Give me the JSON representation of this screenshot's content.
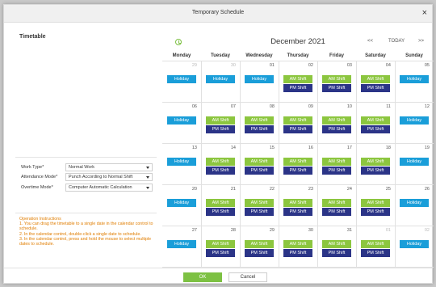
{
  "dialog": {
    "title": "Temporary Schedule",
    "close_symbol": "×"
  },
  "timetable": {
    "title": "Timetable"
  },
  "form": {
    "work_type": {
      "label": "Work Type*",
      "value": "Normal Work"
    },
    "attendance_mode": {
      "label": "Attendance Mode*",
      "value": "Punch According to Normal Shift"
    },
    "overtime_mode": {
      "label": "Overtime Mode*",
      "value": "Computer Automatic Calculation"
    }
  },
  "instructions": {
    "title": "Operation Instructions",
    "lines": [
      "1. You can drag the timetable to a single date in the calendar control to schedule.",
      "2. In the calendar control, double-click a single date to schedule.",
      "3. In the calendar control, press and hold the mouse to select multiple dates to schedule."
    ]
  },
  "calendar": {
    "month": "December 2021",
    "prev": "<<",
    "today": "TODAY",
    "next": ">>",
    "weekdays": [
      "Monday",
      "Tuesday",
      "Wednesday",
      "Thursday",
      "Friday",
      "Saturday",
      "Sunday"
    ],
    "weeks": [
      [
        {
          "day": "29",
          "other": true,
          "items": [
            "Holiday"
          ]
        },
        {
          "day": "30",
          "other": true,
          "items": [
            "Holiday"
          ]
        },
        {
          "day": "01",
          "other": false,
          "items": [
            "Holiday"
          ]
        },
        {
          "day": "02",
          "other": false,
          "items": [
            "AM Shift",
            "PM Shift"
          ]
        },
        {
          "day": "03",
          "other": false,
          "items": [
            "AM Shift",
            "PM Shift"
          ]
        },
        {
          "day": "04",
          "other": false,
          "items": [
            "AM Shift",
            "PM Shift"
          ]
        },
        {
          "day": "05",
          "other": false,
          "items": [
            "Holiday"
          ]
        }
      ],
      [
        {
          "day": "06",
          "other": false,
          "items": [
            "Holiday"
          ]
        },
        {
          "day": "07",
          "other": false,
          "items": [
            "AM Shift",
            "PM Shift"
          ]
        },
        {
          "day": "08",
          "other": false,
          "items": [
            "AM Shift",
            "PM Shift"
          ]
        },
        {
          "day": "09",
          "other": false,
          "items": [
            "AM Shift",
            "PM Shift"
          ]
        },
        {
          "day": "10",
          "other": false,
          "items": [
            "AM Shift",
            "PM Shift"
          ]
        },
        {
          "day": "11",
          "other": false,
          "items": [
            "AM Shift",
            "PM Shift"
          ]
        },
        {
          "day": "12",
          "other": false,
          "items": [
            "Holiday"
          ]
        }
      ],
      [
        {
          "day": "13",
          "other": false,
          "items": [
            "Holiday"
          ]
        },
        {
          "day": "14",
          "other": false,
          "items": [
            "AM Shift",
            "PM Shift"
          ]
        },
        {
          "day": "15",
          "other": false,
          "items": [
            "AM Shift",
            "PM Shift"
          ]
        },
        {
          "day": "16",
          "other": false,
          "items": [
            "AM Shift",
            "PM Shift"
          ]
        },
        {
          "day": "17",
          "other": false,
          "items": [
            "AM Shift",
            "PM Shift"
          ]
        },
        {
          "day": "18",
          "other": false,
          "items": [
            "AM Shift",
            "PM Shift"
          ]
        },
        {
          "day": "19",
          "other": false,
          "items": [
            "Holiday"
          ]
        }
      ],
      [
        {
          "day": "20",
          "other": false,
          "items": [
            "Holiday"
          ]
        },
        {
          "day": "21",
          "other": false,
          "items": [
            "AM Shift",
            "PM Shift"
          ]
        },
        {
          "day": "22",
          "other": false,
          "items": [
            "AM Shift",
            "PM Shift"
          ]
        },
        {
          "day": "23",
          "other": false,
          "items": [
            "AM Shift",
            "PM Shift"
          ]
        },
        {
          "day": "24",
          "other": false,
          "items": [
            "AM Shift",
            "PM Shift"
          ]
        },
        {
          "day": "25",
          "other": false,
          "items": [
            "AM Shift",
            "PM Shift"
          ]
        },
        {
          "day": "26",
          "other": false,
          "items": [
            "Holiday"
          ]
        }
      ],
      [
        {
          "day": "27",
          "other": false,
          "items": [
            "Holiday"
          ]
        },
        {
          "day": "28",
          "other": false,
          "items": [
            "AM Shift",
            "PM Shift"
          ]
        },
        {
          "day": "29",
          "other": false,
          "items": [
            "AM Shift",
            "PM Shift"
          ]
        },
        {
          "day": "30",
          "other": false,
          "items": [
            "AM Shift",
            "PM Shift"
          ]
        },
        {
          "day": "31",
          "other": false,
          "items": [
            "AM Shift",
            "PM Shift"
          ]
        },
        {
          "day": "01",
          "other": true,
          "items": [
            "AM Shift",
            "PM Shift"
          ]
        },
        {
          "day": "02",
          "other": true,
          "items": [
            "Holiday"
          ]
        }
      ]
    ]
  },
  "footer": {
    "ok_label": "OK",
    "cancel_label": "Cancel"
  },
  "colors": {
    "holiday": "#1a9ed9",
    "am_shift": "#8cc63f",
    "pm_shift": "#2b3487",
    "ok_button": "#7dc143"
  },
  "icons": {
    "calendar_state": "clock-icon",
    "close": "close-icon",
    "dropdown": "caret-down-icon"
  }
}
